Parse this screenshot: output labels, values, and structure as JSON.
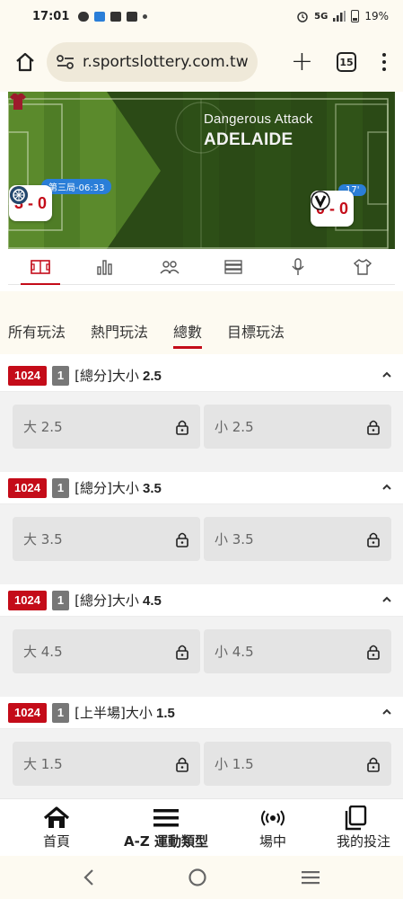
{
  "status_bar": {
    "time": "17:01",
    "network": "5G",
    "battery": "19%"
  },
  "browser": {
    "url": "r.sportslottery.com.tw",
    "tab_count": "15"
  },
  "live": {
    "event_title": "Dangerous Attack",
    "event_team": "ADELAIDE",
    "left_card": {
      "label": "第三局-06:33",
      "score": "3 - 0"
    },
    "right_card": {
      "label": "17'",
      "score": "0 - 0"
    }
  },
  "icon_tabs": [
    "field-icon",
    "stats-icon",
    "lineup-icon",
    "list-icon",
    "microphone-icon",
    "shirt-icon"
  ],
  "filter_tabs": [
    {
      "label": "所有玩法"
    },
    {
      "label": "熱門玩法"
    },
    {
      "label": "總數"
    },
    {
      "label": "目標玩法"
    }
  ],
  "markets": [
    {
      "code": "1024",
      "num": "1",
      "title": "[總分]大小",
      "line": "2.5",
      "over": "大 2.5",
      "under": "小 2.5"
    },
    {
      "code": "1024",
      "num": "1",
      "title": "[總分]大小",
      "line": "3.5",
      "over": "大 3.5",
      "under": "小 3.5"
    },
    {
      "code": "1024",
      "num": "1",
      "title": "[總分]大小",
      "line": "4.5",
      "over": "大 4.5",
      "under": "小 4.5"
    },
    {
      "code": "1024",
      "num": "1",
      "title": "[上半場]大小",
      "line": "1.5",
      "over": "大 1.5",
      "under": "小 1.5"
    }
  ],
  "bottom_nav": [
    {
      "label": "首頁"
    },
    {
      "label": "A-Z 運動類型"
    },
    {
      "label": "場中"
    },
    {
      "label": "我的投注"
    }
  ],
  "colors": {
    "accent": "#c40c19",
    "badge_grey": "#777777",
    "pill_blue": "#2a7ed8",
    "field_green": "#3d6b1f"
  }
}
